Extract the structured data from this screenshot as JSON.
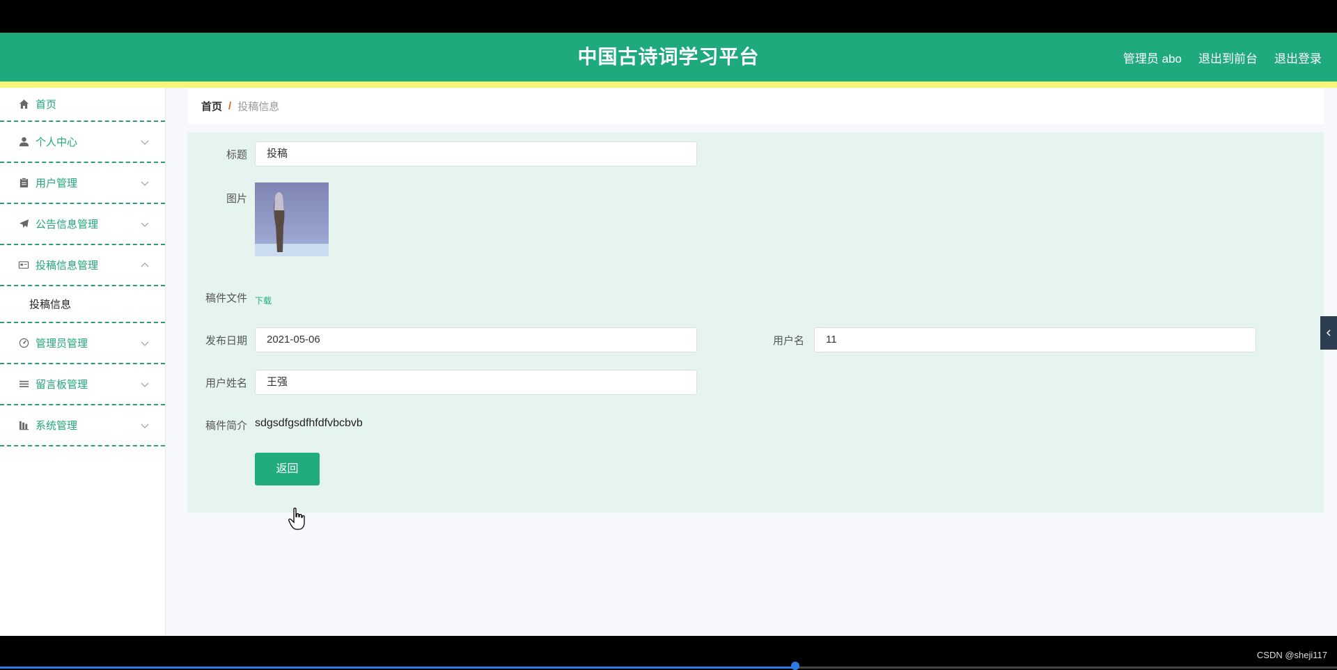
{
  "header": {
    "title": "中国古诗词学习平台",
    "admin": "管理员 abo",
    "to_front": "退出到前台",
    "logout": "退出登录"
  },
  "sidebar": {
    "items": [
      {
        "label": "首页",
        "icon": "home-icon"
      },
      {
        "label": "个人中心",
        "icon": "user-icon"
      },
      {
        "label": "用户管理",
        "icon": "clipboard-icon"
      },
      {
        "label": "公告信息管理",
        "icon": "send-icon"
      },
      {
        "label": "投稿信息管理",
        "icon": "card-icon"
      },
      {
        "label": "管理员管理",
        "icon": "gauge-icon"
      },
      {
        "label": "留言板管理",
        "icon": "list-icon"
      },
      {
        "label": "系统管理",
        "icon": "bars-icon"
      }
    ],
    "submenu_label": "投稿信息"
  },
  "breadcrumb": {
    "home": "首页",
    "separator": "/",
    "current": "投稿信息"
  },
  "form": {
    "title_label": "标题",
    "title_value": "投稿",
    "image_label": "图片",
    "file_label": "稿件文件",
    "download": "下载",
    "date_label": "发布日期",
    "date_value": "2021-05-06",
    "username_label": "用户名",
    "username_value": "11",
    "realname_label": "用户姓名",
    "realname_value": "王强",
    "intro_label": "稿件简介",
    "intro_value": "sdgsdfgsdfhfdfvbcbvb",
    "back_button": "返回"
  },
  "footer": {
    "watermark": "CSDN @sheji117",
    "video_progress": 0.595
  },
  "colors": {
    "primary": "#1eaa7c",
    "accent_strip": "#f6f77a",
    "panel": "#e6f4f0"
  }
}
